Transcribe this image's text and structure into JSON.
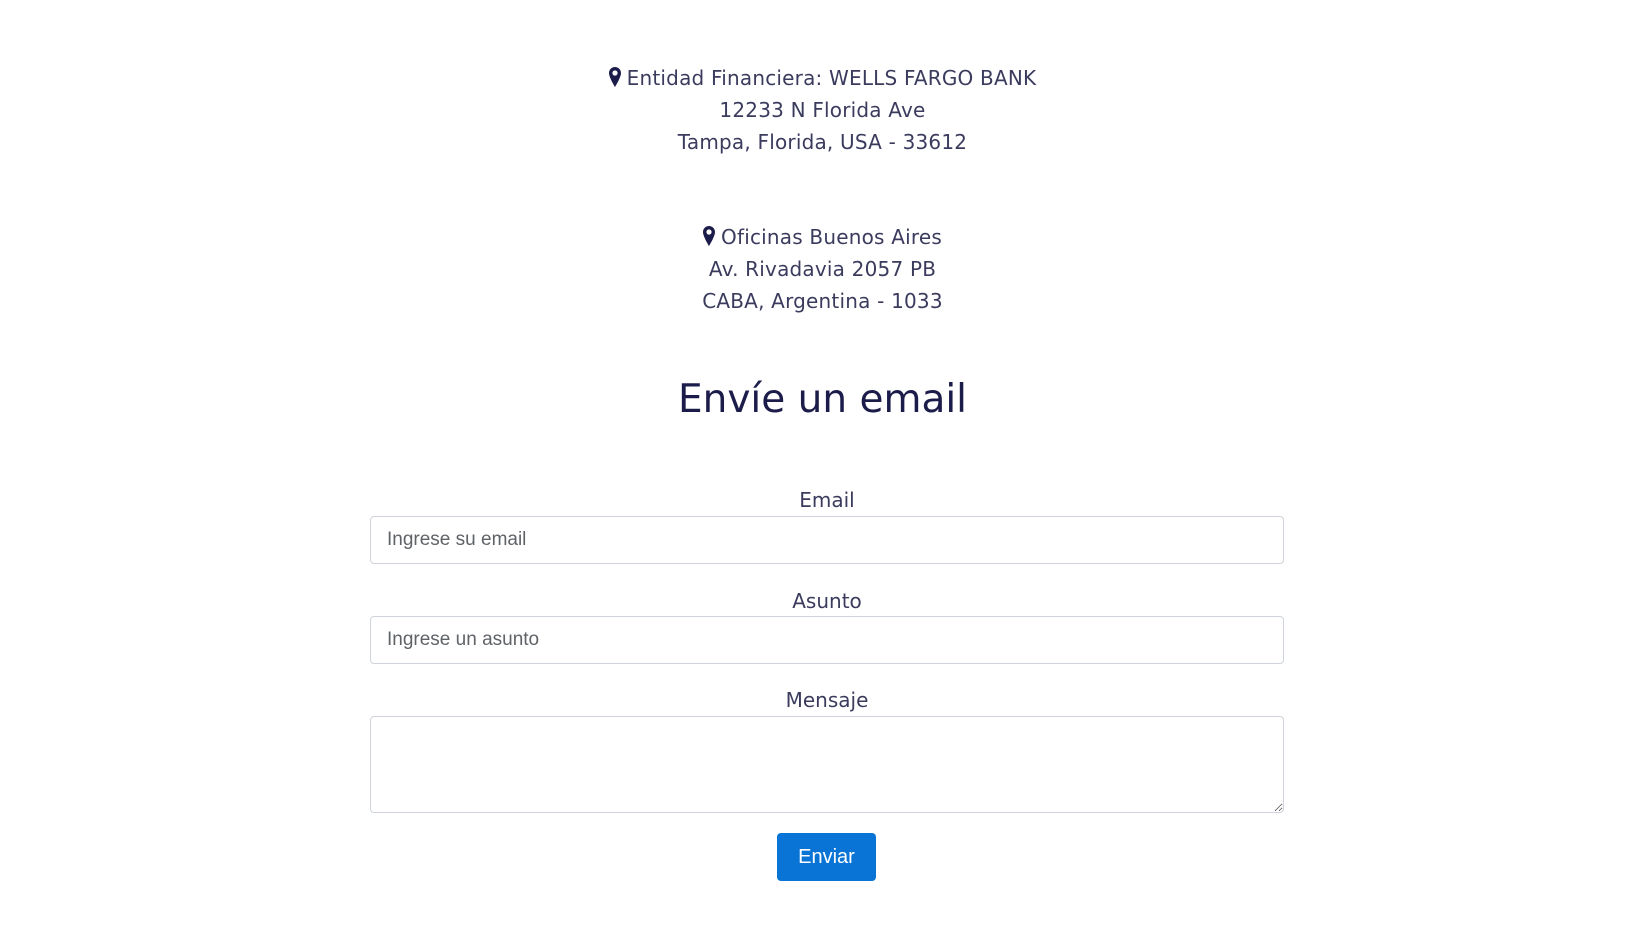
{
  "colors": {
    "accent": "#0a74d6",
    "title": "#1c1c4a",
    "text": "#3b3b5e",
    "border": "#ced4da",
    "pin": "#1c1c4a"
  },
  "locations": [
    {
      "icon": "map-pin-icon",
      "name": "Entidad Financiera: WELLS FARGO BANK",
      "street": "12233 N Florida Ave",
      "city": "Tampa, Florida, USA - 33612"
    },
    {
      "icon": "map-pin-icon",
      "name": "Oficinas Buenos Aires",
      "street": "Av. Rivadavia 2057 PB",
      "city": "CABA, Argentina - 1033"
    }
  ],
  "contact_form": {
    "title": "Envíe un email",
    "email": {
      "label": "Email",
      "placeholder": "Ingrese su email",
      "value": ""
    },
    "subject": {
      "label": "Asunto",
      "placeholder": "Ingrese un asunto",
      "value": ""
    },
    "message": {
      "label": "Mensaje",
      "placeholder": "",
      "value": ""
    },
    "submit_label": "Enviar"
  }
}
